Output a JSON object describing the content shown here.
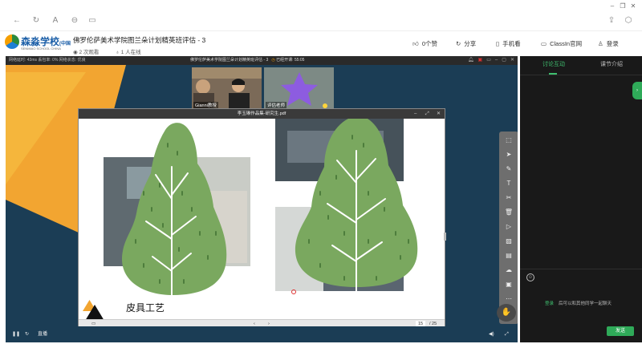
{
  "window_controls": {
    "minimize": "–",
    "restore": "❐",
    "close": "✕"
  },
  "header": {
    "logo_text": "森淼学校",
    "logo_tag": "(中国",
    "logo_sub": "SENMIAO SCHOOL CHINA",
    "title": "佛罗伦萨美术学院图兰朵计划精英班评估 - 3",
    "views": "2 次观看",
    "online": "1 人在线",
    "likes": "0个赞",
    "share": "分享",
    "phone_view": "手机看",
    "classin": "ClassIn官网",
    "login": "登录"
  },
  "classroom": {
    "status_left": "网络延时: 43ms  丢包率: 0%  网络状态: 优良",
    "status_title": "佛罗伦萨美术学院图兰朵计划精英班评估 - 3",
    "status_time": "已经开课: 55:05",
    "video_tiles": [
      {
        "name": "Gianni教授"
      },
      {
        "name": "评估老师"
      }
    ],
    "pdf": {
      "title": "李玉琳作品集-研究生.pdf",
      "slide_title": "皮具工艺",
      "page_current": "15",
      "page_total": "/ 25"
    },
    "bottom_label": "直播"
  },
  "side_panel": {
    "tab_discussion": "讨论互动",
    "tab_intro": "课节介绍",
    "login_link": "登录",
    "login_hint": "后可以和其他同学一起聊天",
    "send": "发送"
  },
  "colors": {
    "accent_green": "#3fbf6f",
    "classroom_bg": "#1b3d55",
    "orange": "#f2a531",
    "tree_green": "#7aa85f"
  }
}
